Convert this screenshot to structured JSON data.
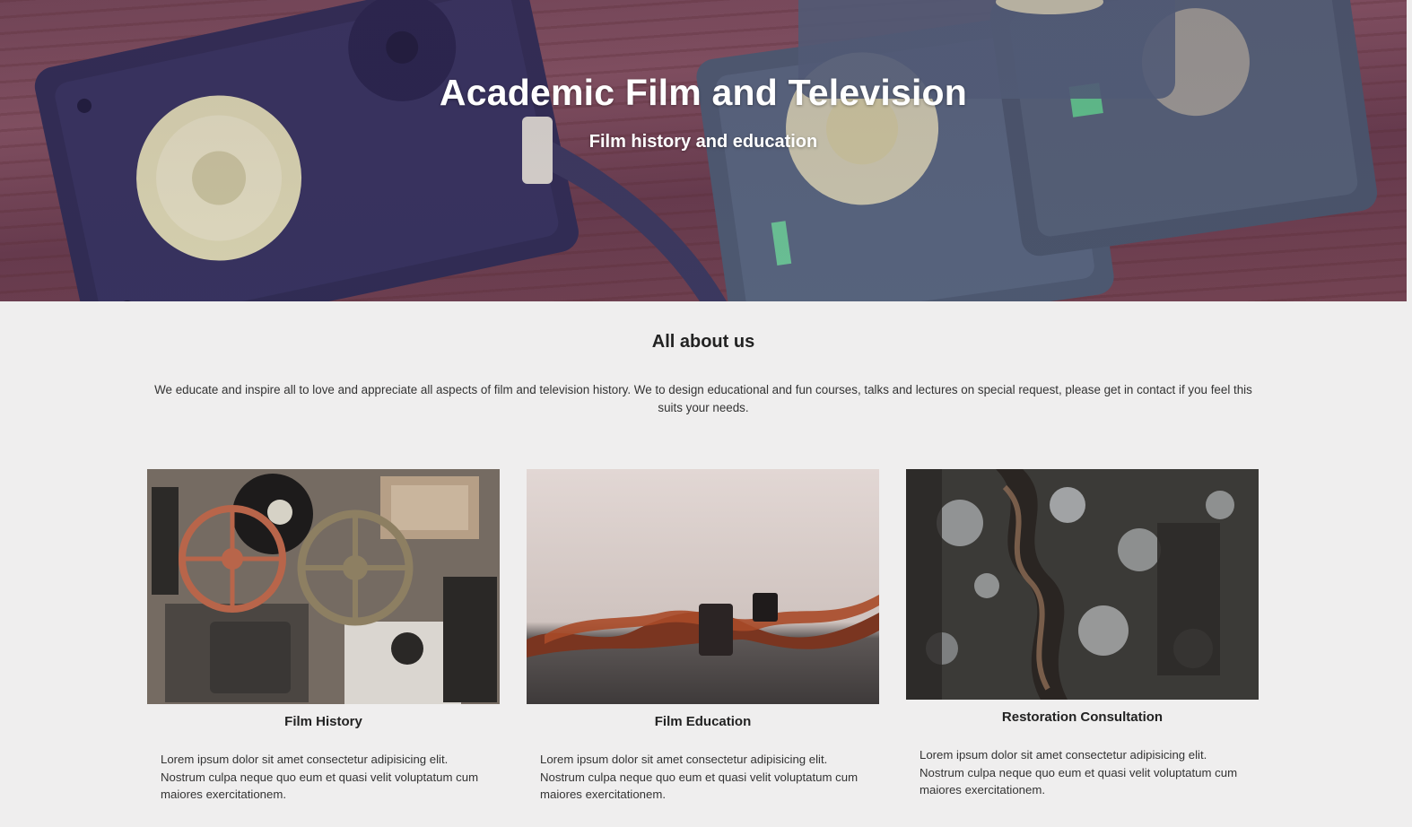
{
  "hero": {
    "title": "Academic Film and Television",
    "subtitle": "Film history and education"
  },
  "about": {
    "heading": "All about us",
    "text": "We educate and inspire all to love and appreciate all aspects of film and television history. We to design educational and fun courses, talks and lectures on special request, please get in contact if you feel this suits your needs."
  },
  "cards": [
    {
      "title": "Film History",
      "text": "Lorem ipsum dolor sit amet consectetur adipisicing elit. Nostrum culpa neque quo eum et quasi velit voluptatum cum maiores exercitationem."
    },
    {
      "title": "Film Education",
      "text": "Lorem ipsum dolor sit amet consectetur adipisicing elit. Nostrum culpa neque quo eum et quasi velit voluptatum cum maiores exercitationem."
    },
    {
      "title": "Restoration Consultation",
      "text": "Lorem ipsum dolor sit amet consectetur adipisicing elit. Nostrum culpa neque quo eum et quasi velit voluptatum cum maiores exercitationem."
    }
  ]
}
